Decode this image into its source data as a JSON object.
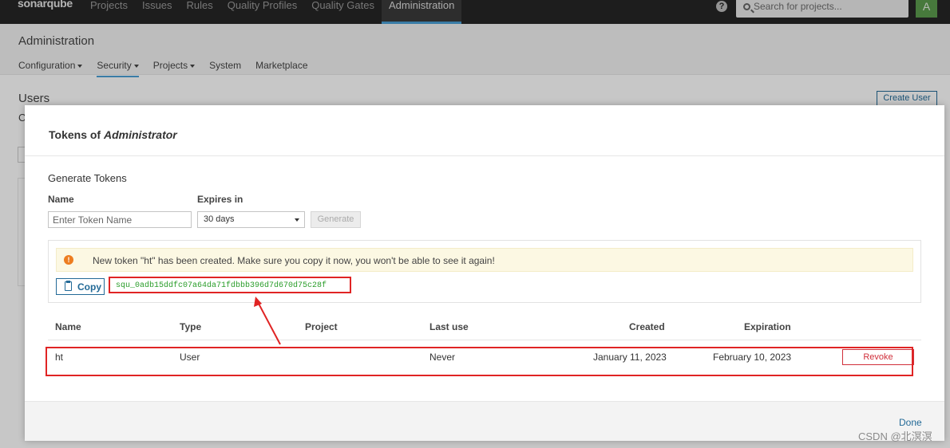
{
  "topnav": {
    "logo": "sonarqube",
    "items": [
      "Projects",
      "Issues",
      "Rules",
      "Quality Profiles",
      "Quality Gates",
      "Administration"
    ],
    "active_index": 5,
    "help": "?",
    "search_placeholder": "Search for projects...",
    "avatar": "A"
  },
  "page": {
    "title": "Administration",
    "subnav": [
      {
        "label": "Configuration",
        "dropdown": true
      },
      {
        "label": "Security",
        "dropdown": true,
        "active": true
      },
      {
        "label": "Projects",
        "dropdown": true
      },
      {
        "label": "System",
        "dropdown": false
      },
      {
        "label": "Marketplace",
        "dropdown": false
      }
    ],
    "users_title": "Users",
    "users_sub": "C",
    "create_user": "Create User"
  },
  "modal": {
    "title_prefix": "Tokens of",
    "title_user": "Administrator",
    "generate_title": "Generate Tokens",
    "name_label": "Name",
    "name_placeholder": "Enter Token Name",
    "expires_label": "Expires in",
    "expires_value": "30 days",
    "generate_button": "Generate",
    "alert_icon": "!",
    "alert_text": "New token \"ht\" has been created. Make sure you copy it now, you won't be able to see it again!",
    "copy_button": "Copy",
    "token_value": "squ_0adb15ddfc07a64da71fdbbb396d7d670d75c28f",
    "table": {
      "headers": [
        "Name",
        "Type",
        "Project",
        "Last use",
        "Created",
        "Expiration"
      ],
      "rows": [
        {
          "name": "ht",
          "type": "User",
          "project": "",
          "last_use": "Never",
          "created": "January 11, 2023",
          "expiration": "February 10, 2023",
          "action": "Revoke"
        }
      ]
    },
    "done": "Done"
  },
  "watermark": "CSDN @北溟溟",
  "colors": {
    "topbar": "#262626",
    "accent": "#4b9fd5",
    "link": "#236a97",
    "danger": "#d02f3a",
    "annotation_red": "#e02424",
    "token_green": "#2a9d2a",
    "alert_bg": "#fcf8e3"
  }
}
